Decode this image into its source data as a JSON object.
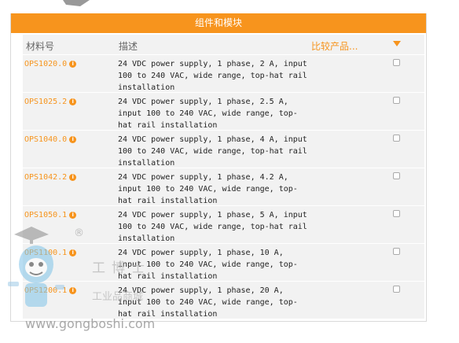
{
  "panel": {
    "title": "组件和模块"
  },
  "table": {
    "headers": {
      "part_number": "材料号",
      "description": "描述",
      "compare": "比较产品..."
    },
    "rows": [
      {
        "part": "OPS1020.0",
        "desc_lines": [
          "24 VDC power supply, 1 phase, 2 A, input",
          "100 to 240 VAC, wide range, top-hat rail",
          "installation"
        ]
      },
      {
        "part": "OPS1025.2",
        "desc_lines": [
          "24 VDC power supply, 1 phase, 2.5 A,",
          "input 100 to 240 VAC, wide range, top-",
          "hat rail installation"
        ]
      },
      {
        "part": "OPS1040.0",
        "desc_lines": [
          "24 VDC power supply, 1 phase, 4 A, input",
          "100 to 240 VAC, wide range, top-hat rail",
          "installation"
        ]
      },
      {
        "part": "OPS1042.2",
        "desc_lines": [
          "24 VDC power supply, 1 phase, 4.2 A,",
          "input 100 to 240 VAC, wide range, top-",
          "hat rail installation"
        ]
      },
      {
        "part": "OPS1050.1",
        "desc_lines": [
          "24 VDC power supply, 1 phase, 5 A, input",
          "100 to 240 VAC, wide range, top-hat rail",
          "installation"
        ]
      },
      {
        "part": "OPS1100.1",
        "desc_lines": [
          "24 VDC power supply, 1 phase, 10 A,",
          "input 100 to 240 VAC, wide range, top-",
          "hat rail installation"
        ]
      },
      {
        "part": "OPS1200.1",
        "desc_lines": [
          "24 VDC power supply, 1 phase, 20 A,",
          "input 100 to 240 VAC, wide range, top-",
          "hat rail installation"
        ]
      }
    ]
  },
  "watermark": {
    "url": "www.gongboshi.com",
    "cn_title": "工博士",
    "cn_sub": "工业品商城",
    "registered": "®"
  },
  "colors": {
    "accent": "#f7941d",
    "row_bg": "#f2f2f2"
  },
  "icons": [
    "info-icon",
    "sort-arrow-icon",
    "checkbox",
    "robot-mascot-watermark"
  ]
}
